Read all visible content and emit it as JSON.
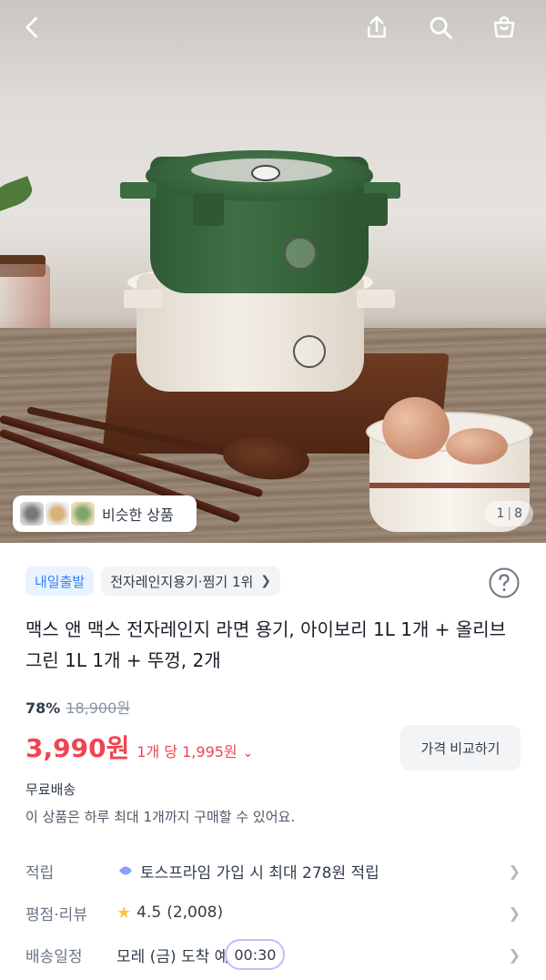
{
  "gallery": {
    "current_page": "1",
    "total_pages": "8",
    "similar_label": "비슷한 상품"
  },
  "tags": {
    "delivery": "내일출발",
    "ranking": "전자레인지용기·찜기 1위"
  },
  "product": {
    "title": "맥스 앤 맥스 전자레인지 라면 용기, 아이보리 1L 1개 + 올리브그린 1L 1개 + 뚜껑, 2개",
    "discount_rate": "78%",
    "original_price": "18,900원",
    "price": "3,990원",
    "unit_price": "1개 당 1,995원",
    "compare_label": "가격 비교하기",
    "shipping": "무료배송",
    "purchase_limit": "이 상품은 하루 최대 1개까지 구매할 수 있어요."
  },
  "info": {
    "points_label": "적립",
    "points_value": "토스프라임 가입 시 최대 278원 적립",
    "rating_label": "평점·리뷰",
    "rating_value": "4.5",
    "review_count": "(2,008)",
    "delivery_label": "배송일정",
    "delivery_value": "모레 (금) 도착 예",
    "timer": "00:30"
  },
  "colors": {
    "accent_blue": "#3182f6",
    "price_red": "#f04452",
    "star": "#ffc342"
  }
}
